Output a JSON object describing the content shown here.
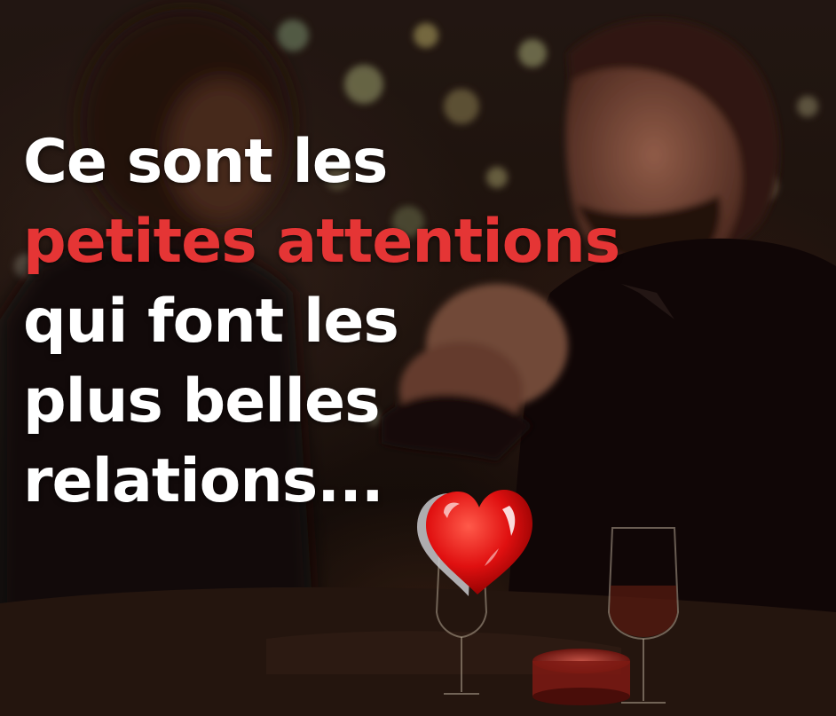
{
  "quote": {
    "lines": [
      "Ce sont les",
      "petites attentions",
      "qui font les",
      "plus belles",
      "relations..."
    ],
    "highlight_line_index": 1
  },
  "colors": {
    "text": "#ffffff",
    "highlight": "#e53535",
    "heart": "#e01010"
  },
  "icons": {
    "heart": "heart-icon"
  }
}
